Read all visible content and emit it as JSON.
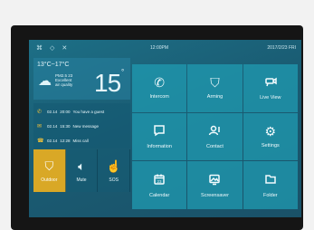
{
  "status": {
    "time": "12:00PM",
    "date": "2017/2/23 FRI",
    "icons": [
      "network-icon",
      "shield-icon",
      "mute-icon"
    ]
  },
  "weather": {
    "range": "13°C~17°C",
    "pm": "PM2.5 23",
    "quality_1": "Excellent",
    "quality_2": "air quality",
    "temp": "15",
    "unit": "°"
  },
  "messages": [
    {
      "icon": "phone-icon",
      "date": "02.14",
      "time": "20:00",
      "text": "You have a guest"
    },
    {
      "icon": "mail-icon",
      "date": "02.14",
      "time": "15:30",
      "text": "New message"
    },
    {
      "icon": "missed-call-icon",
      "date": "02.14",
      "time": "12:28",
      "text": "Miss call"
    }
  ],
  "quick": [
    {
      "label": "Outdoor",
      "icon": "shield-icon",
      "active": true
    },
    {
      "label": "Mute",
      "icon": "speaker-icon",
      "active": false
    },
    {
      "label": "SOS",
      "icon": "hand-icon",
      "active": false
    }
  ],
  "tiles": [
    {
      "label": "Intercom",
      "icon": "phone-icon"
    },
    {
      "label": "Arming",
      "icon": "shield-icon"
    },
    {
      "label": "Live View",
      "icon": "camera-icon"
    },
    {
      "label": "Information",
      "icon": "chat-icon"
    },
    {
      "label": "Contact",
      "icon": "contact-icon"
    },
    {
      "label": "Settings",
      "icon": "gear-icon"
    },
    {
      "label": "Calendar",
      "icon": "calendar-icon",
      "day": "23"
    },
    {
      "label": "Screensaver",
      "icon": "image-icon"
    },
    {
      "label": "Folder",
      "icon": "folder-icon"
    }
  ],
  "colors": {
    "accent": "#d9a826",
    "tile": "#209bb2",
    "screen": "#1a5c73"
  }
}
